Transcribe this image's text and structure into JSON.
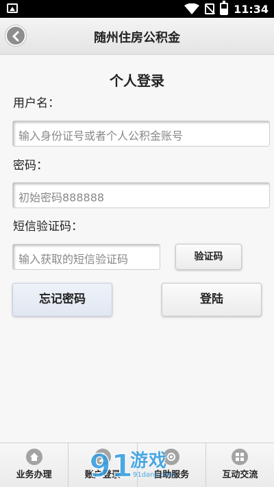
{
  "status_bar": {
    "time": "11:34",
    "icons": [
      "image-icon",
      "wifi-icon",
      "no-sim-icon",
      "battery-icon"
    ]
  },
  "header": {
    "title": "随州住房公积金",
    "back_icon": "back-arrow-icon"
  },
  "form": {
    "title": "个人登录",
    "username_label": "用户名：",
    "username_placeholder": "输入身份证号或者个人公积金账号",
    "password_label": "密码：",
    "password_placeholder": "初始密码888888",
    "sms_label": "短信验证码：",
    "sms_placeholder": "输入获取的短信验证码",
    "get_code_button": "验证码",
    "forgot_button": "忘记密码",
    "login_button": "登陆"
  },
  "bottom_nav": {
    "items": [
      {
        "label": "业务办理",
        "icon": "home-icon"
      },
      {
        "label": "账户登录",
        "icon": "user-icon"
      },
      {
        "label": "自助服务",
        "icon": "service-icon"
      },
      {
        "label": "互动交流",
        "icon": "grid-icon"
      }
    ]
  },
  "watermark": {
    "brand": "游戏",
    "site": "91danji.com",
    "logo_text": "91"
  },
  "colors": {
    "watermark": "#2f9be0",
    "header_bg": "#ececec",
    "forgot_button_bg": "#e6ebf4"
  }
}
